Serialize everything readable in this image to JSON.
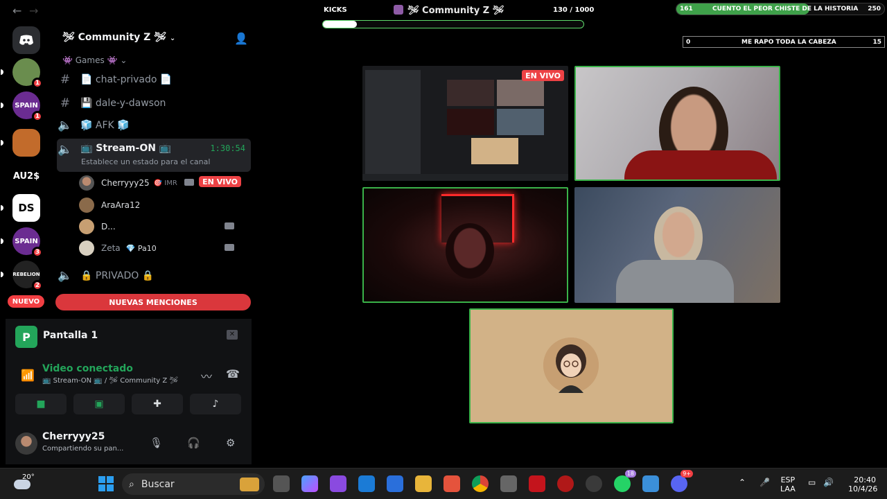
{
  "window": {
    "back_label": "←",
    "forward_label": "→",
    "title": "🛩 Community Z 🛩"
  },
  "overlay": {
    "kicks_label": "KICKS",
    "kicks_count": "130 / 1000",
    "kicks_progress": 0.13,
    "poll_primary": {
      "left": "161",
      "text": "CUENTO EL PEOR CHISTE DE LA HISTORIA",
      "right": "250",
      "progress": 0.64
    },
    "poll_secondary": {
      "left": "0",
      "text": "ME RAPO TODA LA CABEZA",
      "right": "15"
    }
  },
  "servers": [
    {
      "name": "discord-home",
      "label": "",
      "badge": "",
      "color": "#2b2d31"
    },
    {
      "name": "server-1",
      "label": "",
      "badge": "1",
      "color": "#6a8d4e"
    },
    {
      "name": "server-spain-1",
      "label": "SPAIN",
      "badge": "1",
      "color": "#6b2c91"
    },
    {
      "name": "server-3",
      "label": "",
      "badge": "",
      "color": "#c26b2b"
    },
    {
      "name": "server-au",
      "label": "AU2$",
      "badge": "",
      "color": "#000000"
    },
    {
      "name": "server-ds",
      "label": "DS",
      "badge": "",
      "color": "#ffffff"
    },
    {
      "name": "server-spain-2",
      "label": "SPAIN",
      "badge": "3",
      "color": "#6b2c91"
    },
    {
      "name": "server-rebelion",
      "label": "REBELION",
      "badge": "2",
      "color": "#222222"
    }
  ],
  "rail": {
    "new_label": "NUEVO"
  },
  "channels": {
    "server_name": "🛩 Community Z 🛩",
    "category": "👾 Games 👾",
    "items": [
      {
        "icon": "#",
        "label": "📄 chat-privado 📄"
      },
      {
        "icon": "#",
        "label": "💾 dale-y-dawson"
      },
      {
        "icon": "🔈",
        "label": "🧊 AFK 🧊"
      }
    ],
    "active_voice": {
      "label": "📺 Stream-ON 📺",
      "timer": "1:30:54",
      "status": "Establece un estado para el canal"
    },
    "voice_users": [
      {
        "name": "Cherryyy25",
        "extra": "🎯 IMR",
        "live": "EN VIVO"
      },
      {
        "name": "AraAra12",
        "extra": "",
        "live": ""
      },
      {
        "name": "D...",
        "extra": "",
        "live": ""
      },
      {
        "name": "Zeta",
        "extra": "💎 Pa10",
        "live": ""
      }
    ],
    "private": {
      "icon": "🔈",
      "label": "🔒 PRIVADO 🔒"
    },
    "mentions_label": "NUEVAS MENCIONES"
  },
  "screen_share": {
    "icon_letter": "P",
    "name": "Pantalla 1"
  },
  "voice_panel": {
    "status": "Video conectado",
    "sub": "📺 Stream-ON 📺 / 🛩 Community Z 🛩"
  },
  "user": {
    "name": "Cherryyy25",
    "status": "Compartiendo su pan..."
  },
  "stage": {
    "live_label": "EN VIVO"
  },
  "taskbar": {
    "temp": "20°",
    "search_placeholder": "Buscar",
    "lang": "ESP",
    "region": "LAA",
    "time": "20:40",
    "date": "10/4/26",
    "discord_badge": "9+",
    "app_badge": "18"
  },
  "colors": {
    "accent_green": "#23a55a",
    "live_red": "#ed4245",
    "tile_border": "#3ab349"
  }
}
